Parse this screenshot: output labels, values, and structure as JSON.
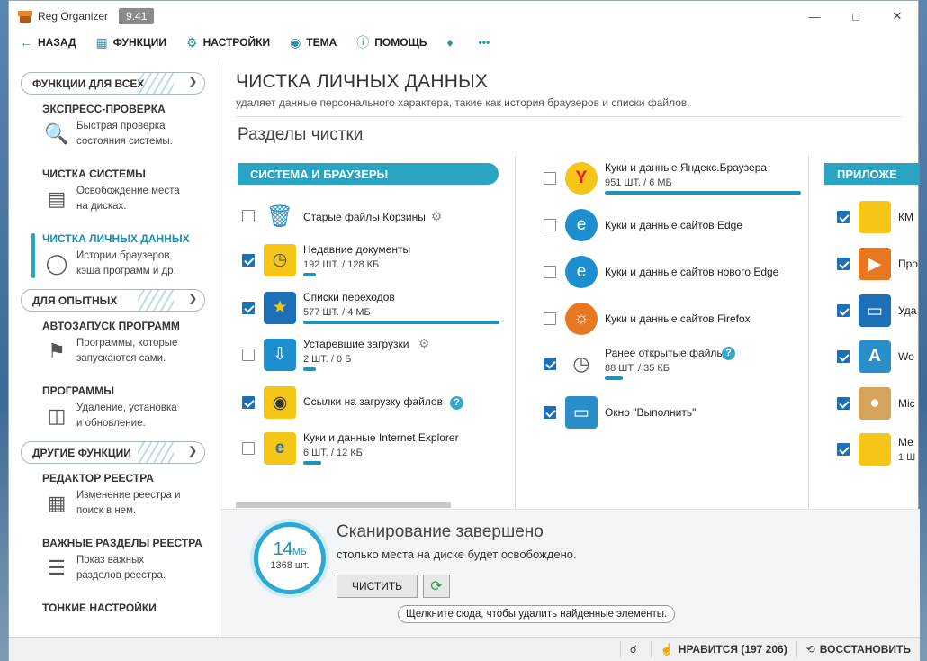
{
  "window": {
    "title": "Reg Organizer",
    "version": "9.41"
  },
  "toolbar": {
    "back": "НАЗАД",
    "functions": "ФУНКЦИИ",
    "settings": "НАСТРОЙКИ",
    "theme": "ТЕМА",
    "help": "ПОМОЩЬ",
    "more": "•••"
  },
  "sidebar": {
    "group1": "ФУНКЦИИ ДЛЯ ВСЕХ",
    "group2": "ДЛЯ ОПЫТНЫХ",
    "group3": "ДРУГИЕ ФУНКЦИИ",
    "items": [
      {
        "title": "ЭКСПРЕСС-ПРОВЕРКА",
        "desc1": "Быстрая проверка",
        "desc2": "состояния системы."
      },
      {
        "title": "ЧИСТКА СИСТЕМЫ",
        "desc1": "Освобождение места",
        "desc2": "на дисках."
      },
      {
        "title": "ЧИСТКА ЛИЧНЫХ ДАННЫХ",
        "desc1": "Истории браузеров,",
        "desc2": "кэша программ и др."
      },
      {
        "title": "АВТОЗАПУСК ПРОГРАММ",
        "desc1": "Программы, которые",
        "desc2": "запускаются сами."
      },
      {
        "title": "ПРОГРАММЫ",
        "desc1": "Удаление, установка",
        "desc2": "и обновление."
      },
      {
        "title": "РЕДАКТОР РЕЕСТРА",
        "desc1": "Изменение реестра и",
        "desc2": "поиск в нем."
      },
      {
        "title": "ВАЖНЫЕ РАЗДЕЛЫ РЕЕСТРА",
        "desc1": "Показ важных",
        "desc2": "разделов реестра."
      },
      {
        "title": "ТОНКИЕ НАСТРОЙКИ",
        "desc1": "",
        "desc2": ""
      }
    ]
  },
  "main": {
    "title": "ЧИСТКА ЛИЧНЫХ ДАННЫХ",
    "subtitle": "удаляет данные персонального характера, такие как история браузеров и списки файлов.",
    "sections_title": "Разделы чистки",
    "section1": "СИСТЕМА И БРАУЗЕРЫ",
    "section3": "ПРИЛОЖЕ",
    "col1": [
      {
        "name": "Старые файлы Корзины",
        "count": ""
      },
      {
        "name": "Недавние документы",
        "count": "192 ШТ. / 128 КБ"
      },
      {
        "name": "Списки переходов",
        "count": "577 ШТ. / 4 МБ"
      },
      {
        "name": "Устаревшие загрузки",
        "count": "2 ШТ. / 0 Б"
      },
      {
        "name": "Ссылки на загрузку файлов",
        "count": ""
      },
      {
        "name": "Куки и данные Internet Explorer",
        "count": "6 ШТ. / 12 КБ"
      }
    ],
    "col2": [
      {
        "name": "Куки и данные Яндекс.Браузера",
        "count": "951 ШТ. / 6 МБ"
      },
      {
        "name": "Куки и данные сайтов Edge",
        "count": ""
      },
      {
        "name": "Куки и данные сайтов нового Edge",
        "count": ""
      },
      {
        "name": "Куки и данные сайтов Firefox",
        "count": ""
      },
      {
        "name": "Ранее открытые файлы",
        "count": "88 ШТ. / 35 КБ"
      },
      {
        "name": "Окно \"Выполнить\"",
        "count": ""
      }
    ],
    "col3": [
      {
        "name": "КМ"
      },
      {
        "name": "Про"
      },
      {
        "name": "Уда"
      },
      {
        "name": "Wo"
      },
      {
        "name": "Mic"
      },
      {
        "name": "Ме",
        "count": "1 Ш"
      }
    ]
  },
  "scan": {
    "size": "14",
    "unit": "МБ",
    "items": "1368 шт.",
    "title": "Сканирование завершено",
    "subtitle": "столько места на диске будет освобождено.",
    "clean_button": "ЧИСТИТЬ",
    "tooltip": "Щелкните сюда, чтобы удалить найденные элементы."
  },
  "status": {
    "likes": "НРАВИТСЯ (197 206)",
    "restore": "ВОССТАНОВИТЬ"
  }
}
